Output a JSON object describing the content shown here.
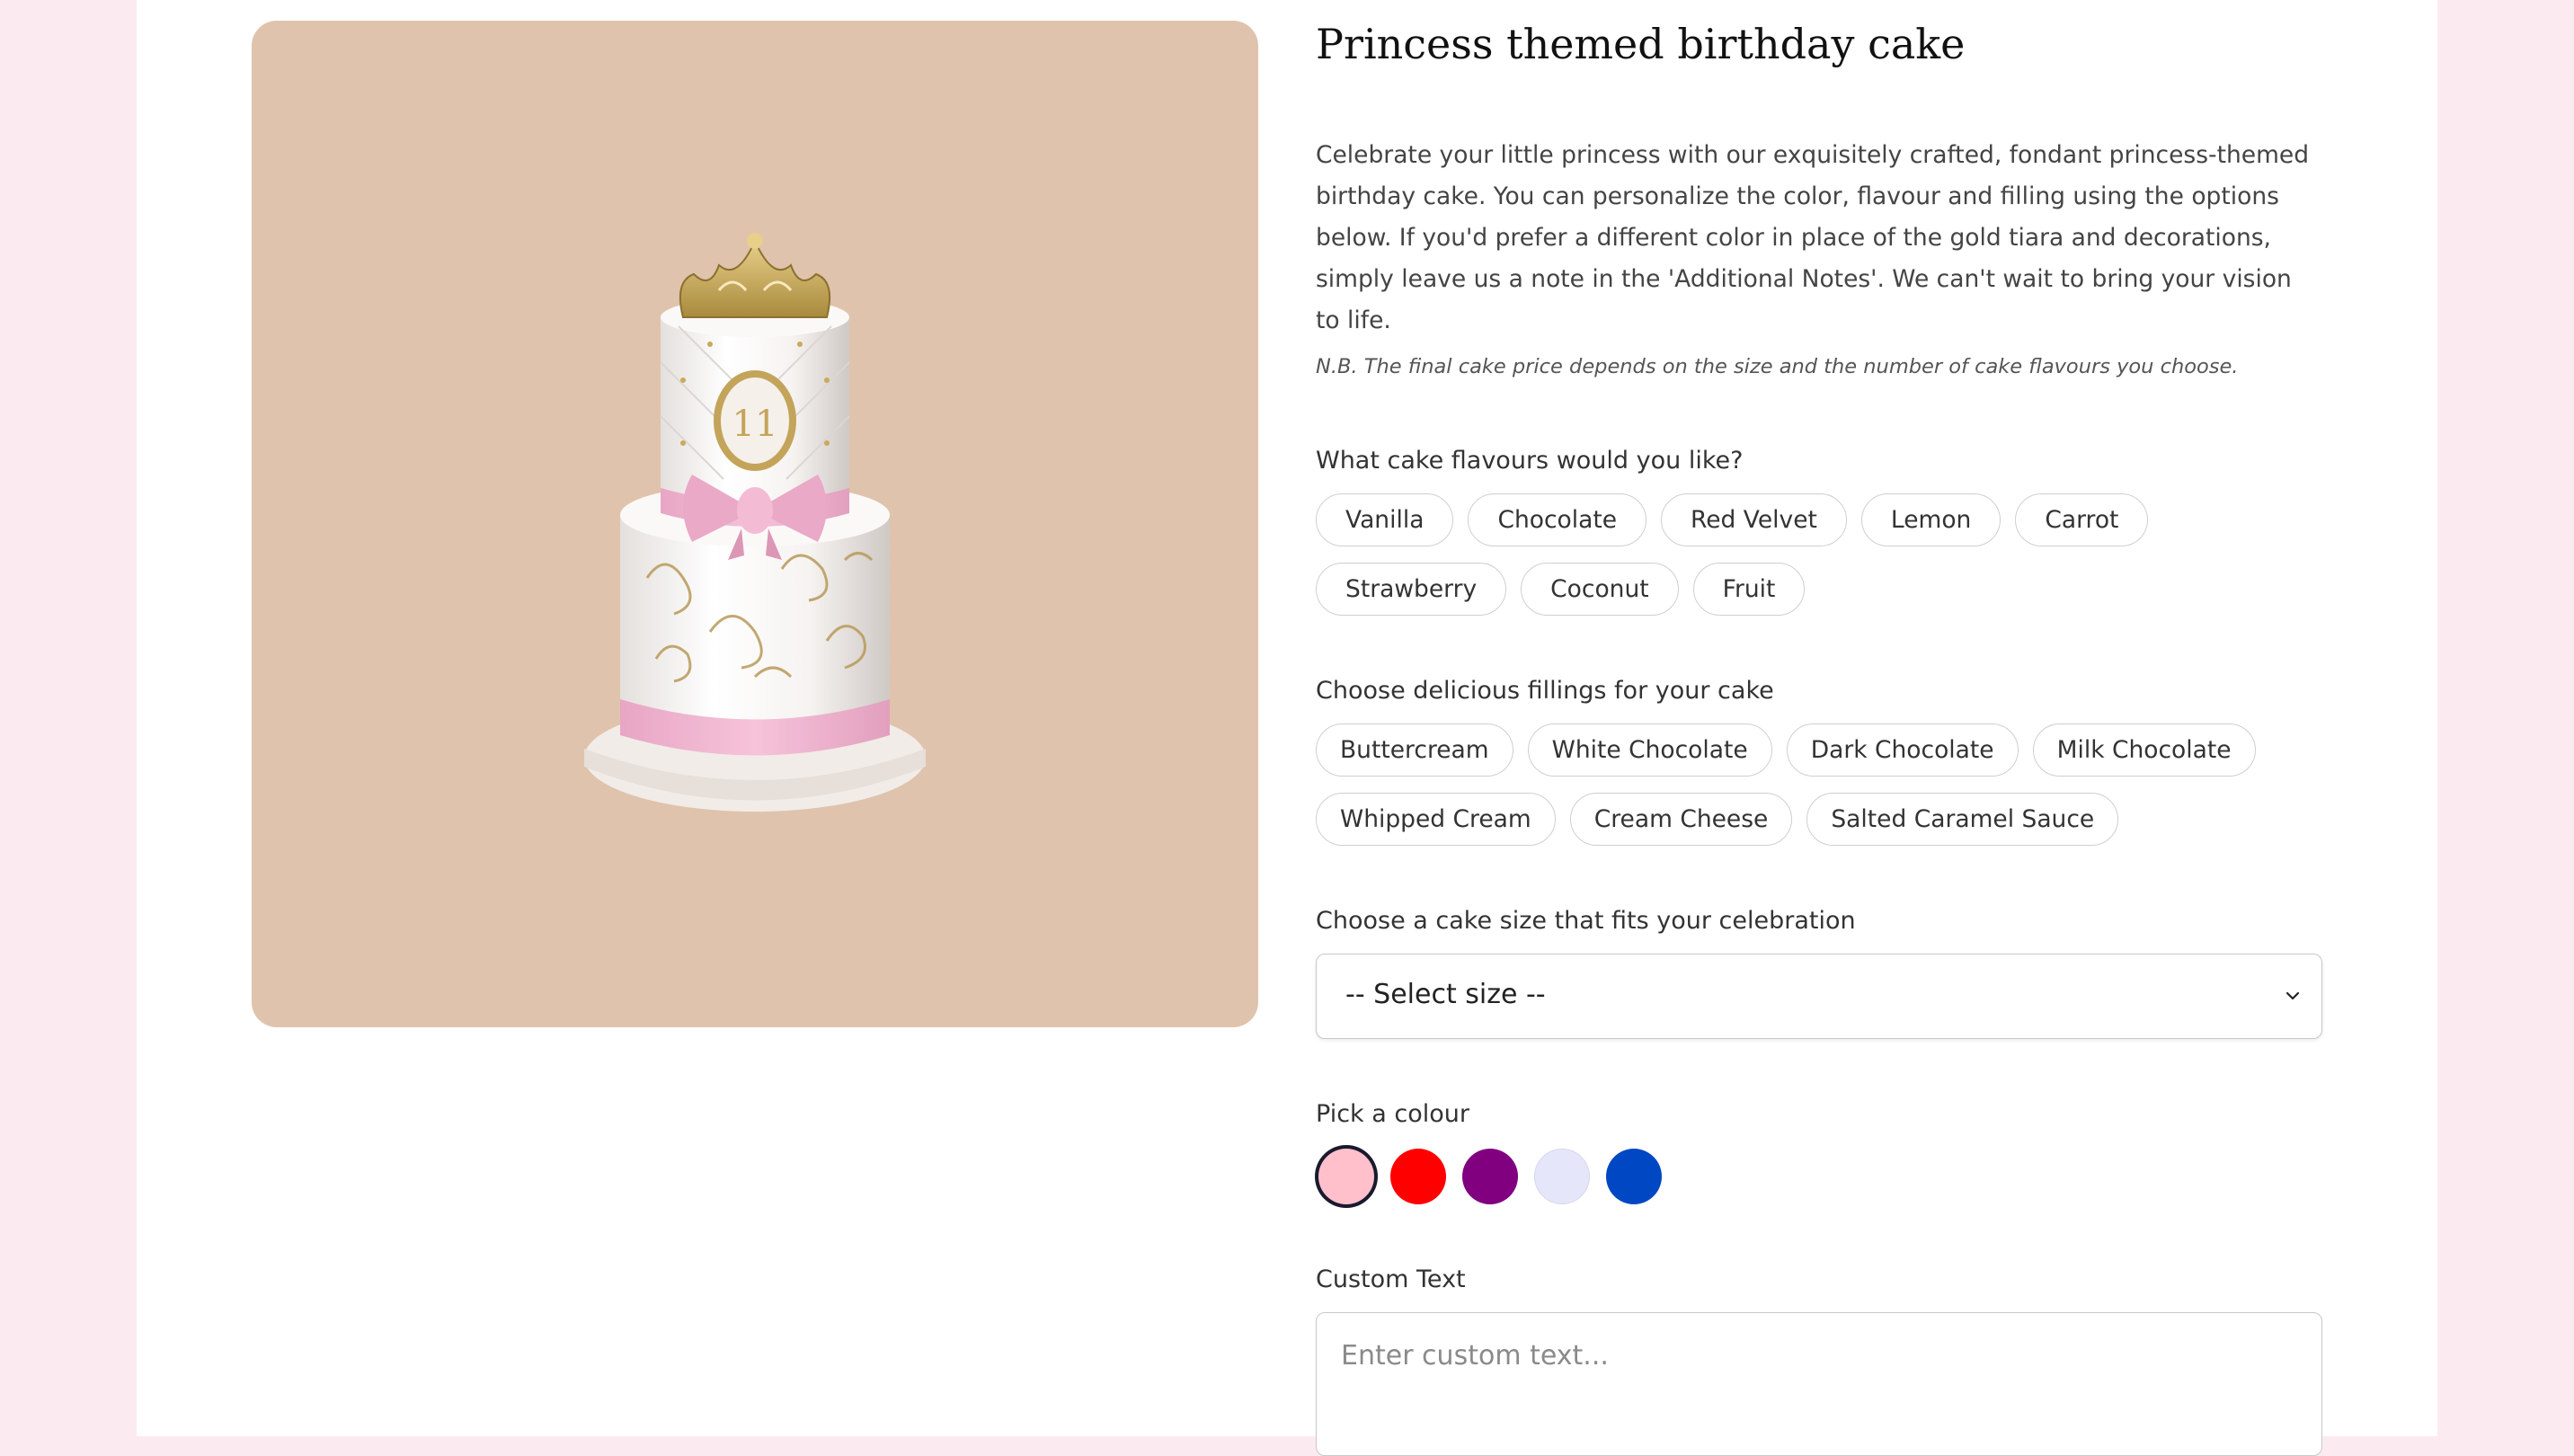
{
  "product": {
    "title": "Princess themed birthday cake",
    "description": "Celebrate your little princess with our exquisitely crafted, fondant princess-themed birthday cake. You can personalize the color, flavour and filling using the options below. If you'd prefer a different color in place of the gold tiara and decorations, simply leave us a note in the 'Additional Notes'. We can't wait to bring your vision to life.",
    "note": "N.B. The final cake price depends on the size and the number of cake flavours you choose.",
    "image_topper_text": "11",
    "image_background": "#e0c3ac"
  },
  "flavours": {
    "label": "What cake flavours would you like?",
    "options": [
      "Vanilla",
      "Chocolate",
      "Red Velvet",
      "Lemon",
      "Carrot",
      "Strawberry",
      "Coconut",
      "Fruit"
    ]
  },
  "fillings": {
    "label": "Choose delicious fillings for your cake",
    "options": [
      "Buttercream",
      "White Chocolate",
      "Dark Chocolate",
      "Milk Chocolate",
      "Whipped Cream",
      "Cream Cheese",
      "Salted Caramel Sauce"
    ]
  },
  "size": {
    "label": "Choose a cake size that fits your celebration",
    "selected": "-- Select size --",
    "icon": "chevron-down-icon"
  },
  "colour": {
    "label": "Pick a colour",
    "swatches": [
      "#ffc0cb",
      "#ff0000",
      "#800080",
      "#e6e6fa",
      "#0047c4"
    ],
    "selected_index": 0
  },
  "custom_text": {
    "label": "Custom Text",
    "placeholder": "Enter custom text..."
  },
  "colors": {
    "page_background": "#fbebf0",
    "card_background": "#ffffff",
    "selected_ring": "#1a1a2e"
  }
}
